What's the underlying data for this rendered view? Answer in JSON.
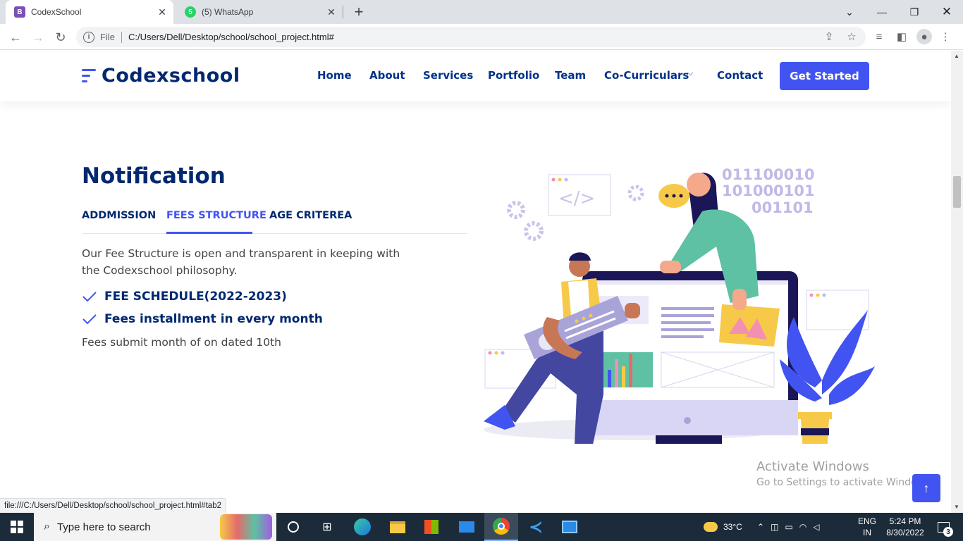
{
  "browser": {
    "tabs": [
      {
        "title": "CodexSchool",
        "favicon_letter": "B",
        "active": true
      },
      {
        "title": "(5) WhatsApp",
        "favicon_letter": "5",
        "active": false
      }
    ],
    "address": {
      "scheme_label": "File",
      "url": "C:/Users/Dell/Desktop/school/school_project.html#"
    },
    "status_url": "file:///C:/Users/Dell/Desktop/school/school_project.html#tab2"
  },
  "site": {
    "brand": "Codexschool",
    "nav": [
      "Home",
      "About",
      "Services",
      "Portfolio",
      "Team",
      "Co-Curriculars",
      "Contact"
    ],
    "cta": "Get Started"
  },
  "section": {
    "title": "Notification",
    "tabs": [
      "ADDMISSION",
      "FEES STRUCTURE",
      "AGE CRITEREA"
    ],
    "active_tab": "FEES STRUCTURE",
    "description": "Our Fee Structure is open and transparent in keeping with the Codexschool philosophy.",
    "items": [
      "FEE SCHEDULE(2022-2023)",
      "Fees installment in every month"
    ],
    "note": "Fees submit month of on dated 10th"
  },
  "illustration": {
    "binary": [
      "011100010",
      "101000101",
      "001101"
    ]
  },
  "watermark": {
    "line1": "Activate Windows",
    "line2": "Go to Settings to activate Windows."
  },
  "taskbar": {
    "search_placeholder": "Type here to search",
    "weather": "33°C",
    "lang": [
      "ENG",
      "IN"
    ],
    "time": "5:24 PM",
    "date": "8/30/2022",
    "notifications": "3"
  },
  "colors": {
    "accent": "#4154f1",
    "heading": "#012970",
    "taskbar": "#1c2b3a"
  }
}
